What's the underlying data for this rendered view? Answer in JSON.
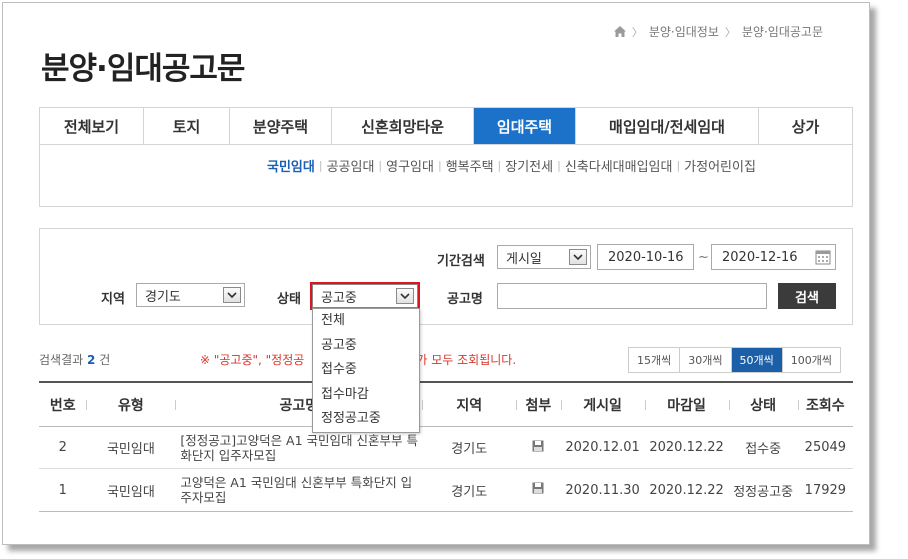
{
  "breadcrumb": {
    "items": [
      "분양·임대정보",
      "분양·임대공고문"
    ]
  },
  "page_title": "분양·임대공고문",
  "main_tabs": [
    {
      "label": "전체보기",
      "active": false
    },
    {
      "label": "토지",
      "active": false
    },
    {
      "label": "분양주택",
      "active": false
    },
    {
      "label": "신혼희망타운",
      "active": false
    },
    {
      "label": "임대주택",
      "active": true
    },
    {
      "label": "매입임대/전세임대",
      "active": false
    },
    {
      "label": "상가",
      "active": false
    }
  ],
  "sub_tabs": [
    {
      "label": "국민임대",
      "active": true
    },
    {
      "label": "공공임대",
      "active": false
    },
    {
      "label": "영구임대",
      "active": false
    },
    {
      "label": "행복주택",
      "active": false
    },
    {
      "label": "장기전세",
      "active": false
    },
    {
      "label": "신축다세대매입임대",
      "active": false
    },
    {
      "label": "가정어린이집",
      "active": false
    }
  ],
  "search": {
    "period_label": "기간검색",
    "period_select": "게시일",
    "date_from": "2020-10-16",
    "date_sep": "~",
    "date_to": "2020-12-16",
    "region_label": "지역",
    "region_select": "경기도",
    "status_label": "상태",
    "status_select": "공고중",
    "name_label": "공고명",
    "name_value": "",
    "search_button": "검색",
    "status_options": [
      "전체",
      "공고중",
      "접수중",
      "접수마감",
      "정정공고중"
    ]
  },
  "results": {
    "count_prefix": "검색결과",
    "count": "2",
    "count_suffix": "건",
    "notice_left": "※ \"공고중\", \"정정공",
    "notice_right": "공고가 모두 조회됩니다.",
    "per_page": [
      {
        "label": "15개씩",
        "active": false
      },
      {
        "label": "30개씩",
        "active": false
      },
      {
        "label": "50개씩",
        "active": true
      },
      {
        "label": "100개씩",
        "active": false
      }
    ]
  },
  "table": {
    "headers": [
      "번호",
      "유형",
      "공고명",
      "지역",
      "첨부",
      "게시일",
      "마감일",
      "상태",
      "조회수"
    ],
    "rows": [
      {
        "no": "2",
        "type": "국민임대",
        "title": "[정정공고]고양덕은 A1 국민임대 신혼부부 특화단지 입주자모집",
        "region": "경기도",
        "posted": "2020.12.01",
        "closing": "2020.12.22",
        "status": "접수중",
        "views": "25049"
      },
      {
        "no": "1",
        "type": "국민임대",
        "title": "고양덕은 A1 국민임대 신혼부부 특화단지 입주자모집",
        "region": "경기도",
        "posted": "2020.11.30",
        "closing": "2020.12.22",
        "status": "정정공고중",
        "views": "17929"
      }
    ]
  },
  "colors": {
    "accent": "#1b72c8",
    "highlight_outline": "#e0141e",
    "notice": "#d9362b"
  }
}
